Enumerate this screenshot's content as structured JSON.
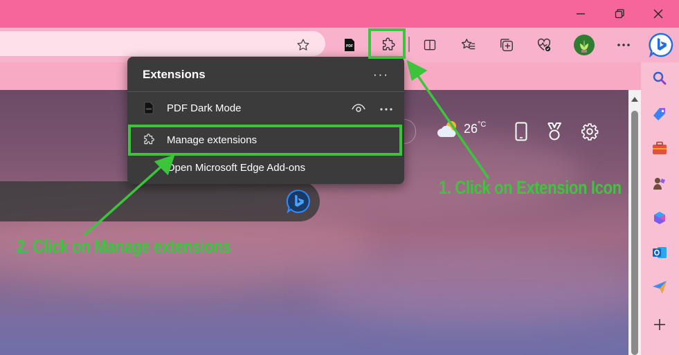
{
  "colors": {
    "titlebar": "#f5679a",
    "toolbar": "#f9b2cb",
    "popup_bg": "#3b3b3b",
    "annotation_green": "#3cc43c"
  },
  "toolbar": {
    "icons": [
      "star-icon",
      "pdf-icon",
      "extensions-icon",
      "split-screen-icon",
      "favorites-icon",
      "collections-icon",
      "browser-essentials-icon",
      "profile-avatar",
      "more-icon",
      "bing-copilot-icon"
    ],
    "pdf_badge": "PDF"
  },
  "extensions_menu": {
    "title": "Extensions",
    "more": "···",
    "items": [
      {
        "label": "PDF Dark Mode",
        "icon": "pdf-icon"
      },
      {
        "label": "Manage extensions",
        "icon": "extensions-icon"
      },
      {
        "label": "Open Microsoft Edge Add-ons",
        "icon": ""
      }
    ]
  },
  "newtab": {
    "temperature": "26",
    "temp_unit": "°C"
  },
  "sidebar": {
    "icons": [
      "search-icon",
      "shopping-icon",
      "tools-icon",
      "games-icon",
      "microsoft365-icon",
      "outlook-icon",
      "send-icon",
      "add-icon"
    ]
  },
  "annotations": {
    "step1": "1. Click on Extension Icon",
    "step2": "2. Click on Manage extensions"
  }
}
